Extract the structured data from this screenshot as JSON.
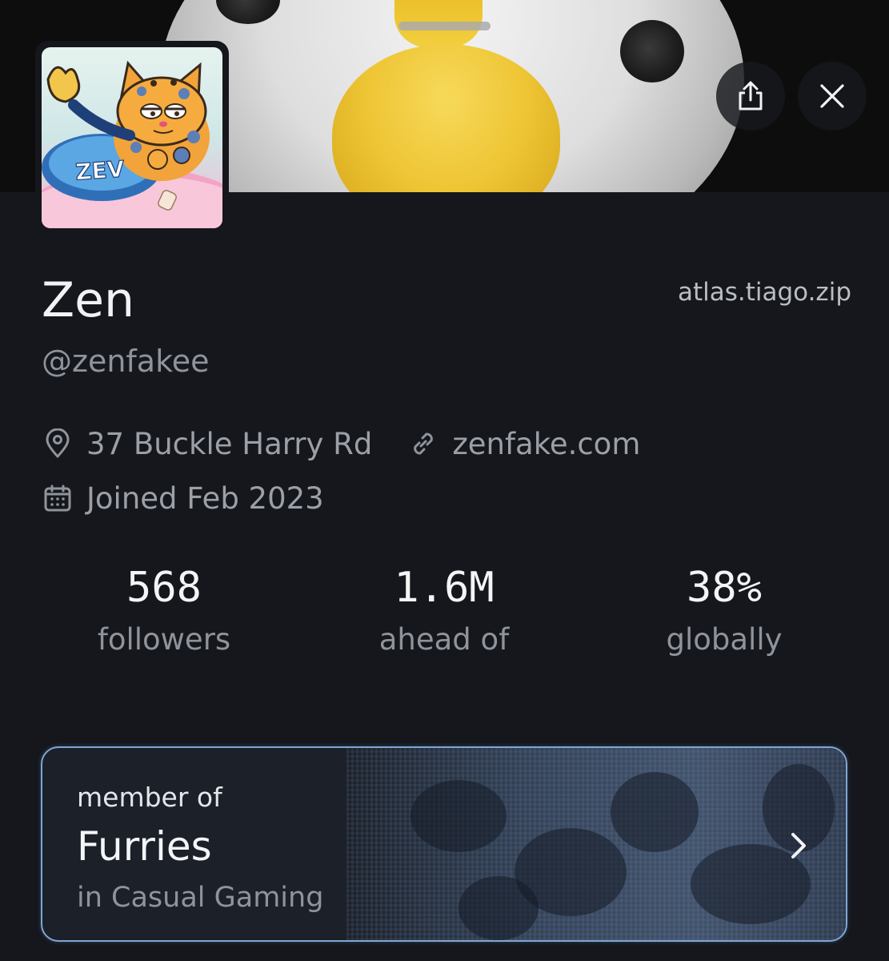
{
  "profile": {
    "display_name": "Zen",
    "handle": "@zenfakee",
    "instance": "atlas.tiago.zip",
    "location": "37 Buckle Harry Rd",
    "website": "zenfake.com",
    "joined": "Joined Feb 2023"
  },
  "avatar": {
    "badge_text": "ZEV"
  },
  "stats": [
    {
      "value": "568",
      "label": "followers"
    },
    {
      "value": "1.6M",
      "label": "ahead of"
    },
    {
      "value": "38%",
      "label": "globally"
    }
  ],
  "community": {
    "label": "member of",
    "name": "Furries",
    "category": "in Casual Gaming"
  },
  "icons": {
    "share": "share-icon",
    "close": "close-icon",
    "location": "map-pin-icon",
    "link": "link-icon",
    "calendar": "calendar-icon",
    "chevron": "chevron-right-icon"
  },
  "colors": {
    "background": "#15171c",
    "card_border": "#7fa6d2",
    "secondary_text": "#8e939c"
  }
}
